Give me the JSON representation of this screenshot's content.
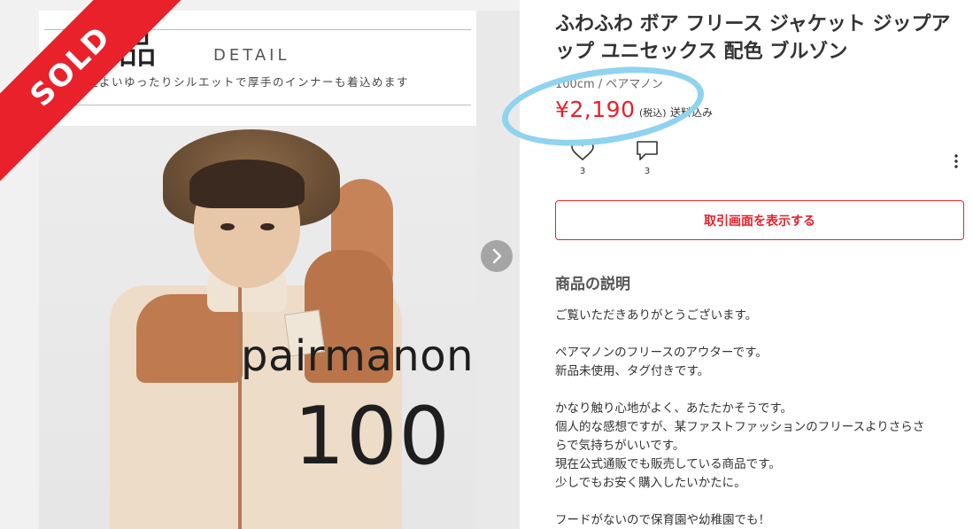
{
  "gallery": {
    "sold_label": "SOLD",
    "image": {
      "title": "新品",
      "detail_label": "DETAIL",
      "subtitle": "程よいゆったりシルエットで厚手のインナーも着込めます",
      "brand": "pairmanon",
      "size": "100"
    },
    "next_icon": "chevron-right-icon"
  },
  "product": {
    "title": "ふわふわ ボア フリース ジャケット ジップアップ ユニセックス 配色 ブルゾン",
    "variant": "100cm / ペアマノン",
    "price": "¥2,190",
    "tax_label": "(税込)",
    "shipping_label": "送料込み",
    "likes": {
      "icon": "heart-icon",
      "count": "3"
    },
    "comments": {
      "icon": "comment-icon",
      "count": "3"
    },
    "more_icon": "more-vertical-icon",
    "action_button": "取引画面を表示する",
    "description_heading": "商品の説明",
    "description_lines": [
      "ご覧いただきありがとうございます。",
      "",
      "ペアマノンのフリースのアウターです。",
      "新品未使用、タグ付きです。",
      "",
      "かなり触り心地がよく、あたたかそうです。",
      "個人的な感想ですが、某ファストファッションのフリースよりさらさ",
      "らで気持ちがいいです。",
      "現在公式通販でも販売している商品です。",
      "少しでもお安く購入したいかたに。",
      "",
      "フードがないので保育園や幼稚園でも！"
    ]
  },
  "colors": {
    "accent_red": "#e8212a",
    "highlight_circle": "#8fd3f0"
  }
}
